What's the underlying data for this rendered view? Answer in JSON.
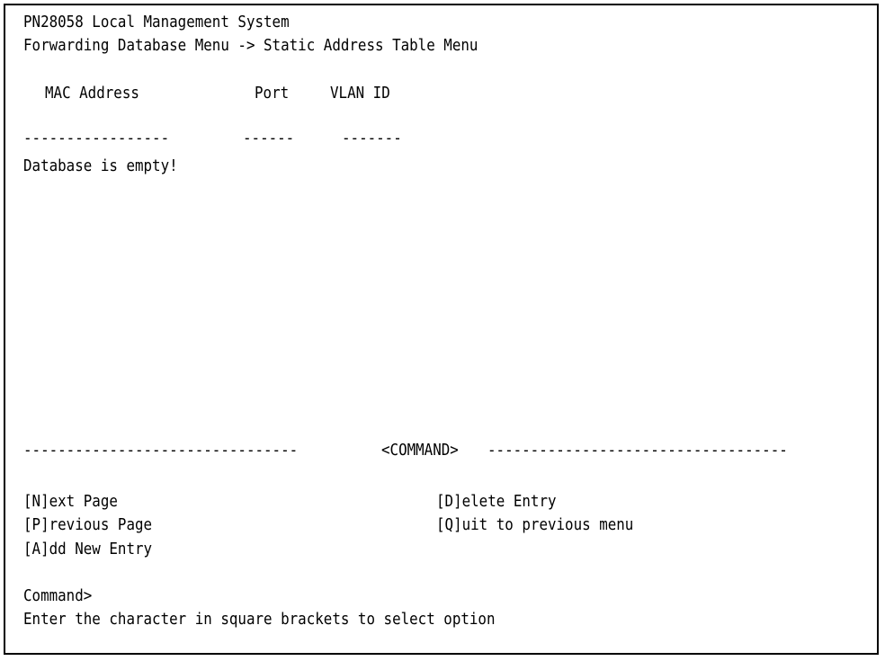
{
  "header": {
    "system_title": "PN28058 Local Management System",
    "breadcrumb": "Forwarding Database Menu -> Static Address Table Menu"
  },
  "table": {
    "columns": [
      "MAC Address",
      "Port",
      "VLAN ID"
    ],
    "underlines": [
      "-----------------",
      "------",
      "-------"
    ],
    "empty_message": "Database is empty!"
  },
  "command_divider": {
    "left_dashes": "--------------------------------",
    "label": "<COMMAND>",
    "right_dashes": "-----------------------------------"
  },
  "commands": {
    "next_page": "[N]ext Page",
    "previous_page": "[P]revious Page",
    "add_new_entry": "[A]dd New Entry",
    "delete_entry": "[D]elete Entry",
    "quit": "[Q]uit to previous menu"
  },
  "prompt": {
    "label": "Command>",
    "hint": "Enter the character in square brackets to select option"
  }
}
